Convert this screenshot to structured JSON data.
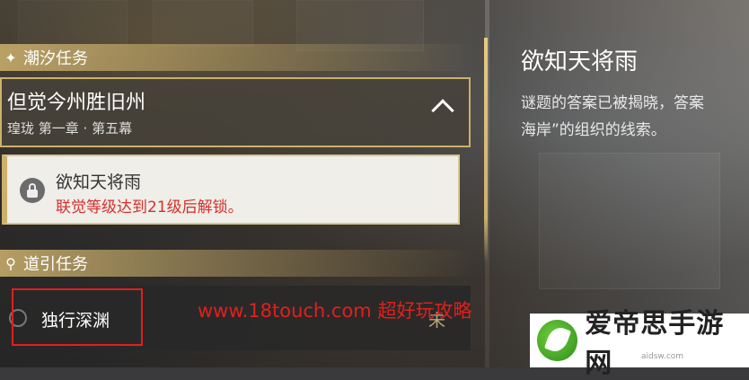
{
  "tide_section": {
    "icon": "sparkle-icon",
    "label": "潮汐任务"
  },
  "main_quest": {
    "title": "但觉今州胜旧州",
    "subtitle": "瑝珑 第一章 · 第五幕",
    "toggle_icon": "chevron-up-icon"
  },
  "locked_quest": {
    "title": "欲知天将雨",
    "requirement": "联觉等级达到21级后解锁。",
    "icon": "lock-icon"
  },
  "guide_section": {
    "icon": "location-pin-icon",
    "label": "道引任务"
  },
  "guide_quest": {
    "name": "独行深渊",
    "tail_text": "未"
  },
  "details": {
    "title": "欲知天将雨",
    "line1": "谜题的答案已被揭晓，答案",
    "line2": "海岸”的组织的线索。"
  },
  "watermark": "www.18touch.com 超好玩攻略",
  "logo": {
    "text": "爱帝思手游网",
    "sub": "aidsw.com"
  },
  "colors": {
    "accent_gold": "#cdb06a",
    "warning_red": "#d6302c",
    "highlight_red": "#e0201c"
  }
}
